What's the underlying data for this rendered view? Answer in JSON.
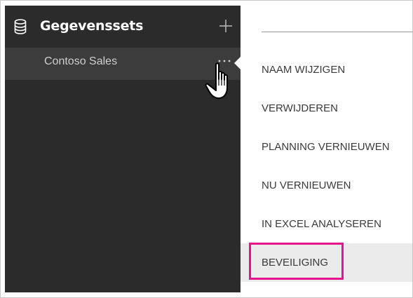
{
  "sidebar": {
    "title": "Gegevenssets",
    "icon": "database-icon",
    "add_icon": "plus-icon",
    "items": [
      {
        "label": "Contoso Sales",
        "more_icon": "ellipsis-icon"
      }
    ]
  },
  "menu": {
    "items": [
      {
        "label": "NAAM WIJZIGEN"
      },
      {
        "label": "VERWIJDEREN"
      },
      {
        "label": "PLANNING VERNIEUWEN"
      },
      {
        "label": "NU VERNIEUWEN"
      },
      {
        "label": "IN EXCEL ANALYSEREN"
      },
      {
        "label": "BEVEILIGING",
        "state": "hover",
        "highlighted": true
      }
    ]
  },
  "colors": {
    "sidebar_bg": "#2b2b2b",
    "selected_row_bg": "#3c3c3c",
    "menu_hover_bg": "#ebebeb",
    "highlight": "#e6148c"
  }
}
